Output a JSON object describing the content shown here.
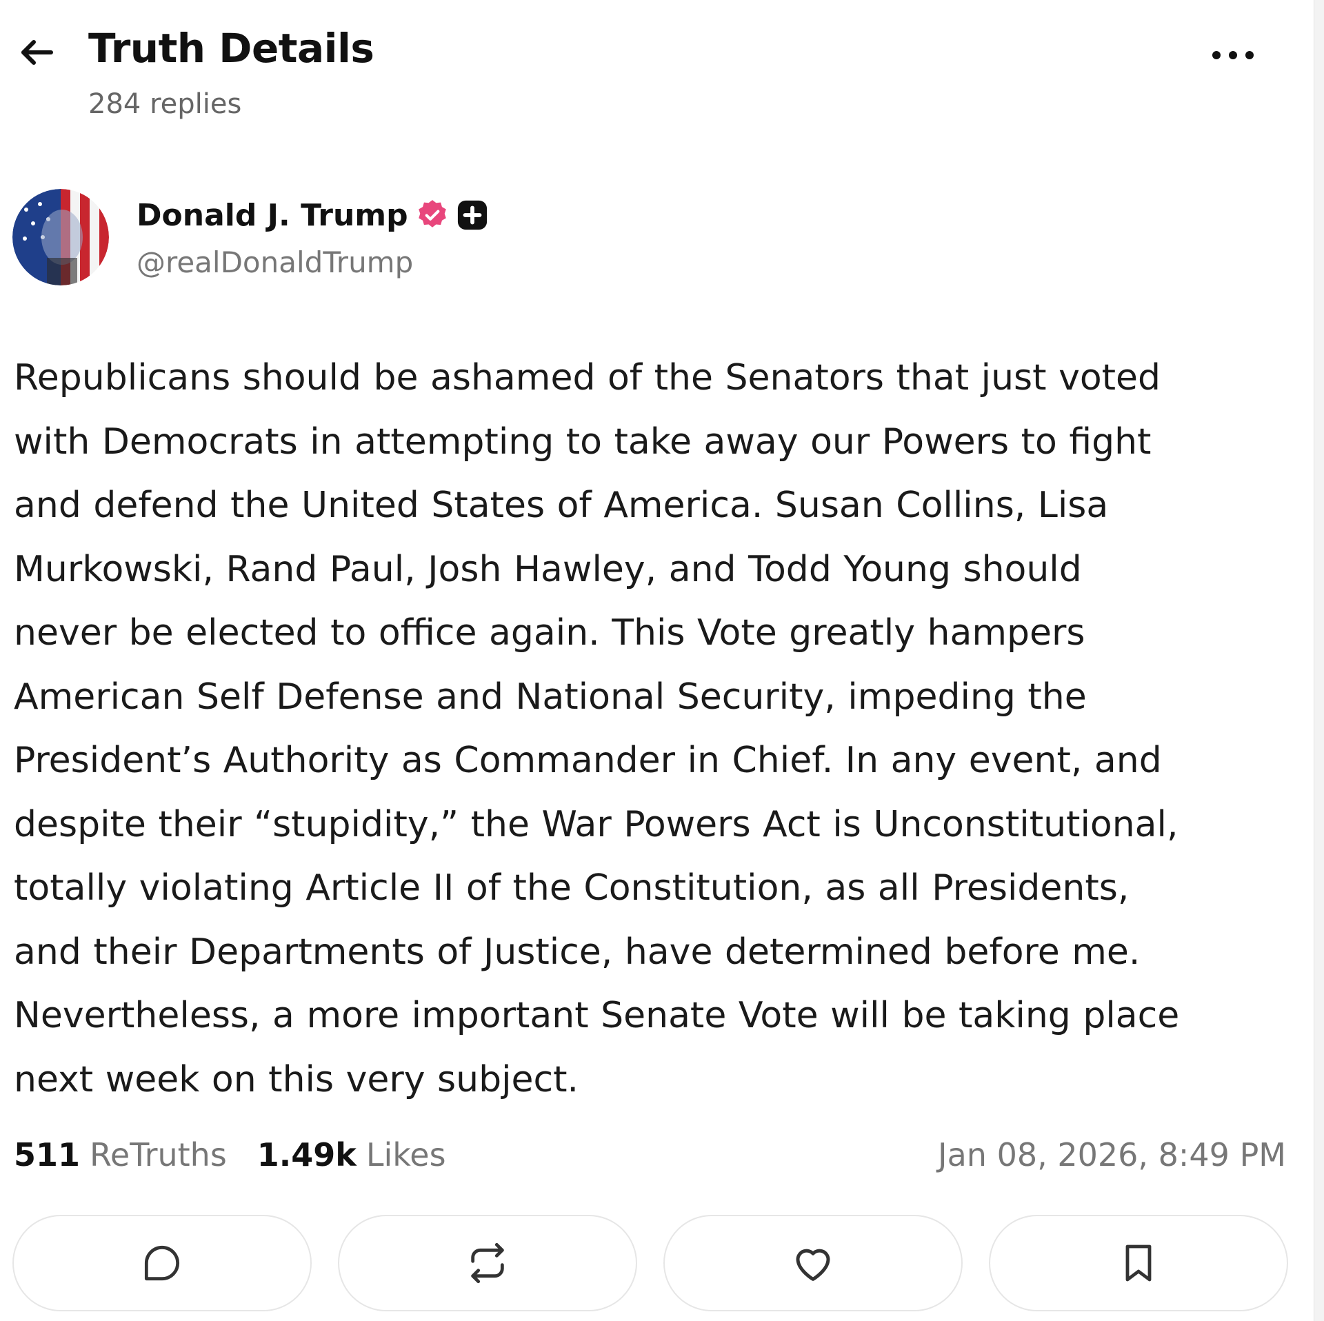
{
  "header": {
    "title": "Truth Details",
    "reply_count": "284 replies"
  },
  "author": {
    "display_name": "Donald J. Trump",
    "handle": "@realDonaldTrump",
    "verified_badge_color": "#e8467c"
  },
  "post": {
    "lines": [
      "Republicans should be ashamed of the Senators that just voted",
      "with Democrats in attempting to take away our Powers to fight",
      "and defend the United States of America. Susan Collins, Lisa",
      "Murkowski, Rand Paul, Josh Hawley, and Todd Young should",
      "never be elected to office again. This Vote greatly hampers",
      "American Self Defense and National Security, impeding the",
      "President’s Authority as Commander in Chief. In any event, and",
      "despite their “stupidity,” the War Powers Act is Unconstitutional,",
      "totally violating Article II of the Constitution, as all Presidents,",
      "and their Departments of Justice, have determined before me.",
      "Nevertheless, a more important Senate Vote will be taking place",
      "next week on this very subject."
    ]
  },
  "stats": {
    "retruths_count": "511",
    "retruths_label": "ReTruths",
    "likes_count": "1.49k",
    "likes_label": "Likes",
    "timestamp": "Jan 08, 2026, 8:49 PM"
  },
  "actions": {
    "icons": [
      "reply-icon",
      "retruth-icon",
      "like-icon",
      "bookmark-icon"
    ]
  }
}
